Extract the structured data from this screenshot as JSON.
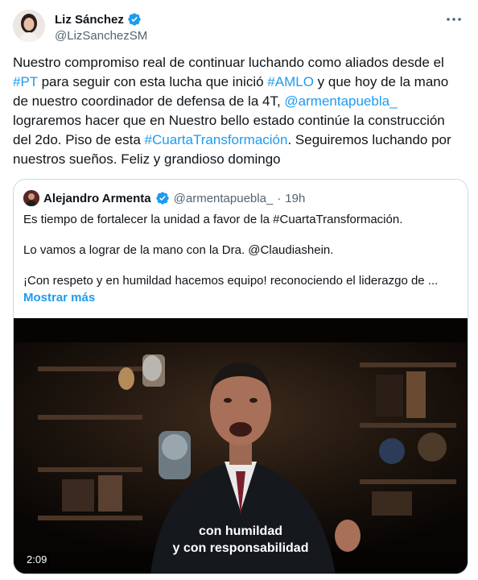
{
  "author": {
    "display_name": "Liz Sánchez",
    "handle": "@LizSanchezSM"
  },
  "tweet": {
    "segments": [
      {
        "text": "Nuestro compromiso real de continuar luchando como aliados desde el ",
        "type": "text"
      },
      {
        "text": "#PT",
        "type": "link"
      },
      {
        "text": " para seguir con esta lucha que inició ",
        "type": "text"
      },
      {
        "text": "#AMLO",
        "type": "link"
      },
      {
        "text": " y que hoy de la mano de nuestro  coordinador de defensa de la 4T, ",
        "type": "text"
      },
      {
        "text": "@armentapuebla_",
        "type": "link"
      },
      {
        "text": " lograremos hacer que en Nuestro bello estado continúe la construcción del 2do. Piso de esta ",
        "type": "text"
      },
      {
        "text": "#CuartaTransformación",
        "type": "link"
      },
      {
        "text": ". Seguiremos luchando por nuestros sueños. Feliz y grandioso domingo",
        "type": "text"
      }
    ]
  },
  "quote": {
    "display_name": "Alejandro Armenta",
    "handle": "@armentapuebla_",
    "separator": "·",
    "time": "19h",
    "paragraphs": [
      "Es tiempo de fortalecer la unidad a favor de la #CuartaTransformación.",
      "Lo vamos a lograr de la mano con la Dra. @Claudiashein.",
      "¡Con respeto y en humildad hacemos equipo! reconociendo el liderazgo de ..."
    ],
    "show_more": "Mostrar más",
    "video": {
      "caption_line1": "con humildad",
      "caption_line2": "y con responsabilidad",
      "duration": "2:09"
    }
  },
  "colors": {
    "link": "#1d9bf0",
    "verified": "#1d9bf0",
    "text": "#0f1419",
    "muted": "#536471",
    "border": "#cfd9de"
  },
  "icons": [
    "verified-badge-icon",
    "more-options-icon"
  ]
}
